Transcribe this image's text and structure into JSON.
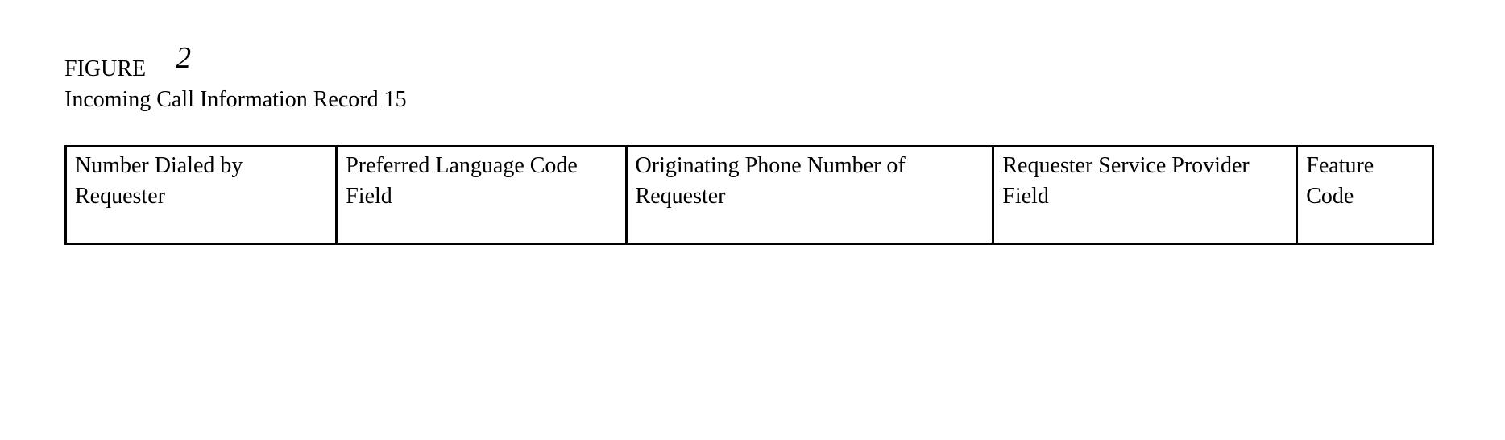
{
  "figure": {
    "label": "FIGURE",
    "number": "2"
  },
  "subtitle": "Incoming Call Information Record 15",
  "fields": {
    "col1": "Number Dialed by Requester",
    "col2": "Preferred Language Code Field",
    "col3": "Originating Phone Number of Requester",
    "col4": "Requester Service Provider Field",
    "col5": "Feature Code"
  }
}
